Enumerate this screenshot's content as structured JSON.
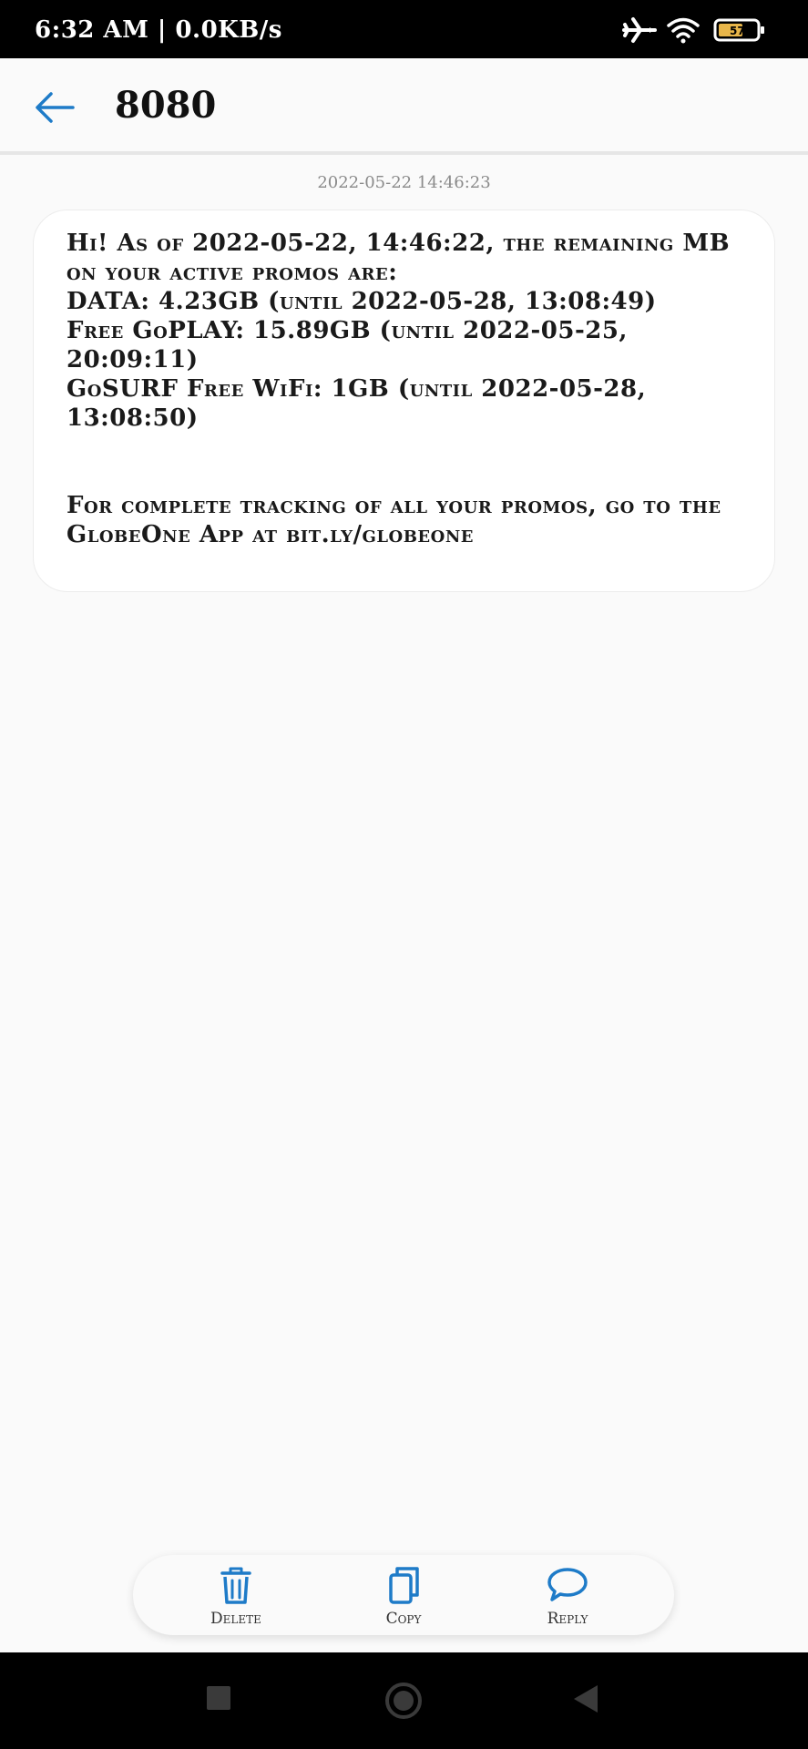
{
  "status_bar": {
    "time_speed": "6:32 AM | 0.0KB/s",
    "icons": [
      "airplane-icon",
      "wifi-icon",
      "battery-icon"
    ],
    "battery_level": "57"
  },
  "header": {
    "title": "8080",
    "back_icon": "arrow-left-icon"
  },
  "message": {
    "timestamp": "2022-05-22 14:46:23",
    "body": "Hi! As of 2022-05-22, 14:46:22, the remaining MB on your active promos are:\nDATA: 4.23GB (until 2022-05-28, 13:08:49)\nFree GoPLAY: 15.89GB (until 2022-05-25, 20:09:11)\nGoSURF Free WiFi: 1GB (until 2022-05-28, 13:08:50)\n\n\nFor complete tracking of all your promos, go to the GlobeOne App at bit.ly/globeone"
  },
  "actions": {
    "delete_label": "Delete",
    "copy_label": "Copy",
    "reply_label": "Reply"
  },
  "colors": {
    "accent": "#1e7bc8",
    "background": "#fafafa",
    "status_bar": "#000000",
    "battery_fill": "#e8b64a"
  },
  "nav_bar": {
    "buttons": [
      "recents-square-icon",
      "home-circle-icon",
      "back-triangle-icon"
    ]
  }
}
